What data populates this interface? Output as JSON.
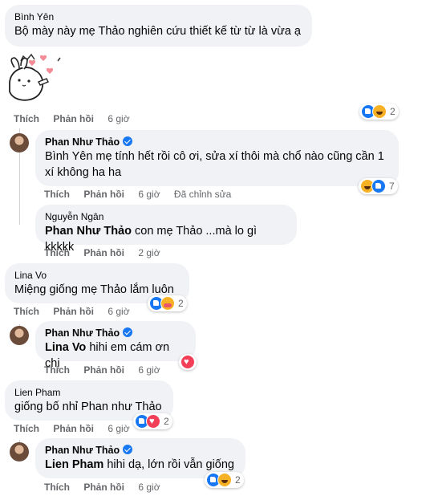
{
  "c1": {
    "author": "Bình Yên",
    "text": "Bộ mày này mẹ Thảo nghiên cứu thiết kế từ từ là vừa ạ",
    "like": "Thích",
    "reply": "Phản hồi",
    "time": "6 giờ",
    "count": "2"
  },
  "r1": {
    "author": "Phan Như Thảo",
    "line1": "Bình Yên mẹ tính hết rồi cô ơi, sửa xí thôi mà chổ nào cũng cần 1",
    "line2": "xí không ha ha",
    "like": "Thích",
    "reply": "Phản hồi",
    "time": "6 giờ",
    "edited": "Đã chỉnh sửa",
    "count": "7"
  },
  "r2": {
    "author": "Nguyễn Ngân",
    "mention": "Phan Như Thảo",
    "text": " con mẹ Thảo ...mà lo gì kkkkk",
    "like": "Thích",
    "reply": "Phản hồi",
    "time": "2 giờ"
  },
  "c2": {
    "author": "Lina Vo",
    "text": "Miệng giống mẹ Thảo lắm luôn",
    "like": "Thích",
    "reply": "Phản hồi",
    "time": "6 giờ",
    "count": "2"
  },
  "r3": {
    "author": "Phan Như Thảo",
    "mention": "Lina Vo",
    "text": " hihi em cám ơn chị",
    "like": "Thích",
    "reply": "Phản hồi",
    "time": "6 giờ"
  },
  "c3": {
    "author": "Lien Pham",
    "text": "giống bố nhỉ Phan như Thảo",
    "like": "Thích",
    "reply": "Phản hồi",
    "time": "6 giờ",
    "count": "2"
  },
  "r4": {
    "author": "Phan Như Thảo",
    "mention": "Lien Pham",
    "text": " hihi dạ, lớn rồi vẫn giống",
    "like": "Thích",
    "reply": "Phản hồi",
    "time": "6 giờ",
    "count": "2"
  }
}
